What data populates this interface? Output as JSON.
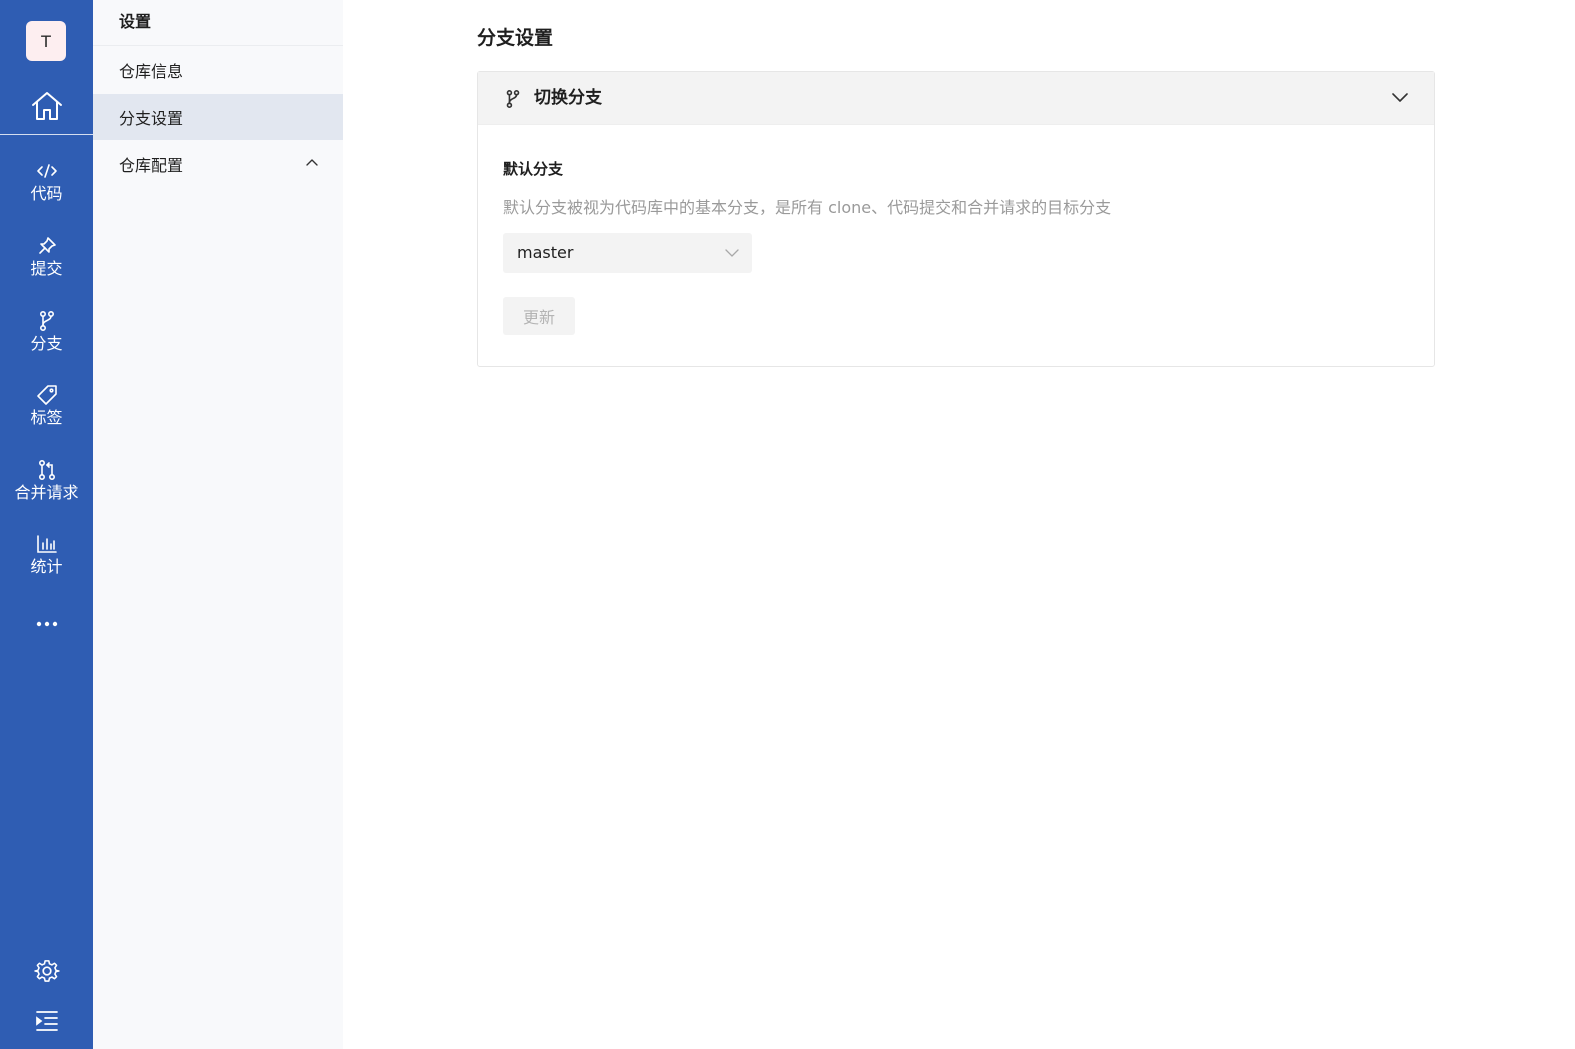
{
  "rail": {
    "avatar_letter": "T",
    "home_icon": "home-icon",
    "items": [
      {
        "label": "代码",
        "icon": "code-icon"
      },
      {
        "label": "提交",
        "icon": "pin-icon"
      },
      {
        "label": "分支",
        "icon": "branch-icon"
      },
      {
        "label": "标签",
        "icon": "tag-icon"
      },
      {
        "label": "合并请求",
        "icon": "merge-request-icon"
      },
      {
        "label": "统计",
        "icon": "bar-chart-icon"
      }
    ],
    "more_icon": "more-icon",
    "settings_icon": "gear-icon",
    "collapse_icon": "collapse-menu-icon",
    "background": "#2f5db3"
  },
  "sidebar": {
    "title": "设置",
    "items": [
      {
        "label": "仓库信息",
        "active": false
      },
      {
        "label": "分支设置",
        "active": true
      },
      {
        "label": "仓库配置",
        "active": false,
        "expanded": true
      }
    ]
  },
  "main": {
    "page_title": "分支设置",
    "card": {
      "title": "切换分支",
      "field_label": "默认分支",
      "field_description": "默认分支被视为代码库中的基本分支，是所有 clone、代码提交和合并请求的目标分支",
      "select_value": "master",
      "update_button": "更新"
    }
  }
}
